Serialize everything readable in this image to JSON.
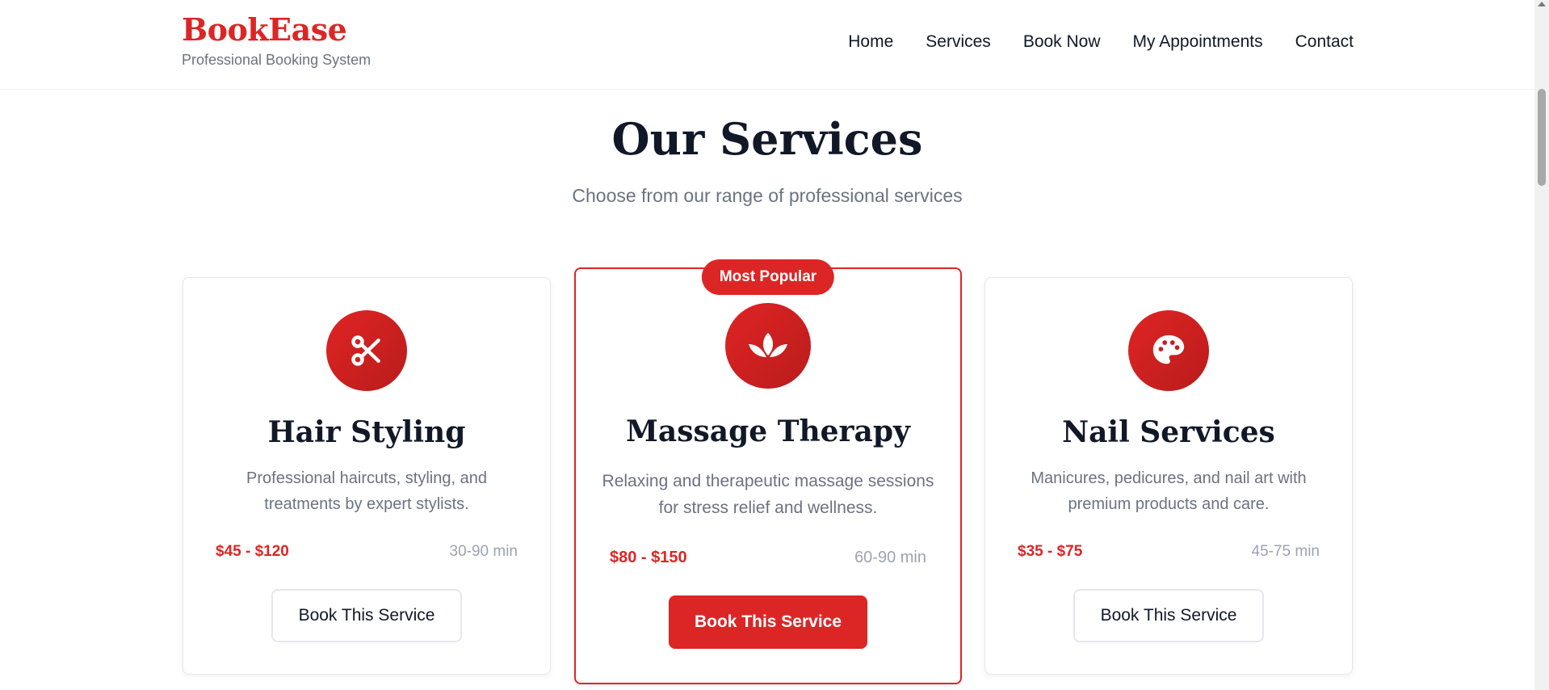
{
  "header": {
    "brand_name": "BookEase",
    "tagline": "Professional Booking System",
    "nav": [
      "Home",
      "Services",
      "Book Now",
      "My Appointments",
      "Contact"
    ]
  },
  "main": {
    "title": "Our Services",
    "subtitle": "Choose from our range of professional services"
  },
  "services": [
    {
      "icon": "scissors-icon",
      "title": "Hair Styling",
      "description": "Professional haircuts, styling, and treatments by expert stylists.",
      "price": "$45 - $120",
      "duration": "30-90 min",
      "button": "Book This Service",
      "featured": false
    },
    {
      "icon": "lotus-icon",
      "badge": "Most Popular",
      "title": "Massage Therapy",
      "description": "Relaxing and therapeutic massage sessions for stress relief and wellness.",
      "price": "$80 - $150",
      "duration": "60-90 min",
      "button": "Book This Service",
      "featured": true
    },
    {
      "icon": "palette-icon",
      "title": "Nail Services",
      "description": "Manicures, pedicures, and nail art with premium products and care.",
      "price": "$35 - $75",
      "duration": "45-75 min",
      "button": "Book This Service",
      "featured": false
    }
  ],
  "colors": {
    "accent": "#dc2626",
    "text": "#111827",
    "muted": "#6b7280"
  }
}
